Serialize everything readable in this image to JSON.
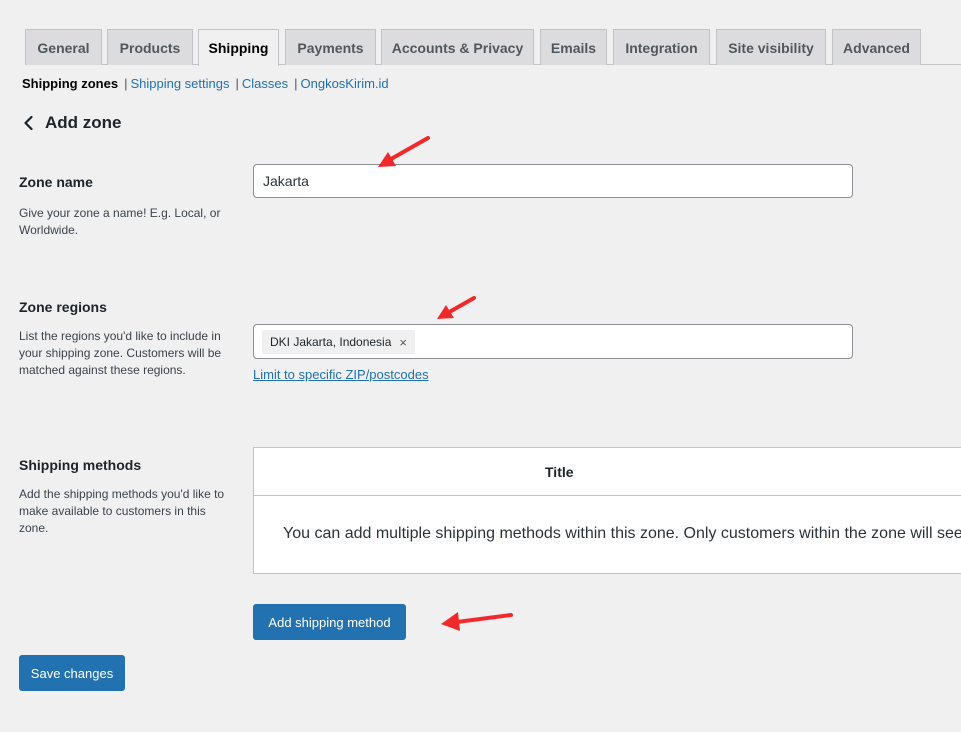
{
  "tabs": [
    {
      "label": "General"
    },
    {
      "label": "Products"
    },
    {
      "label": "Shipping"
    },
    {
      "label": "Payments"
    },
    {
      "label": "Accounts & Privacy"
    },
    {
      "label": "Emails"
    },
    {
      "label": "Integration"
    },
    {
      "label": "Site visibility"
    },
    {
      "label": "Advanced"
    }
  ],
  "subnav": {
    "current": "Shipping zones",
    "separator": "|",
    "links": [
      "Shipping settings",
      "Classes",
      "OngkosKirim.id"
    ]
  },
  "header": {
    "back_icon": "chevron-left-icon",
    "title": "Add zone"
  },
  "zone_name": {
    "label": "Zone name",
    "description": "Give your zone a name! E.g. Local, or Worldwide.",
    "value": "Jakarta"
  },
  "zone_regions": {
    "label": "Zone regions",
    "description": "List the regions you'd like to include in your shipping zone. Customers will be matched against these regions.",
    "chips": [
      "DKI Jakarta, Indonesia"
    ],
    "chip_remove": "×",
    "limit_link": "Limit to specific ZIP/postcodes"
  },
  "shipping_methods": {
    "label": "Shipping methods",
    "description": "Add the shipping methods you'd like to make available to customers in this zone.",
    "column_title": "Title",
    "empty_text": "You can add multiple shipping methods within this zone. Only customers within the zone will see them.",
    "add_button": "Add shipping method"
  },
  "save_button": "Save changes",
  "colors": {
    "accent": "#2271b1",
    "annotation_arrow": "#f0292b"
  }
}
